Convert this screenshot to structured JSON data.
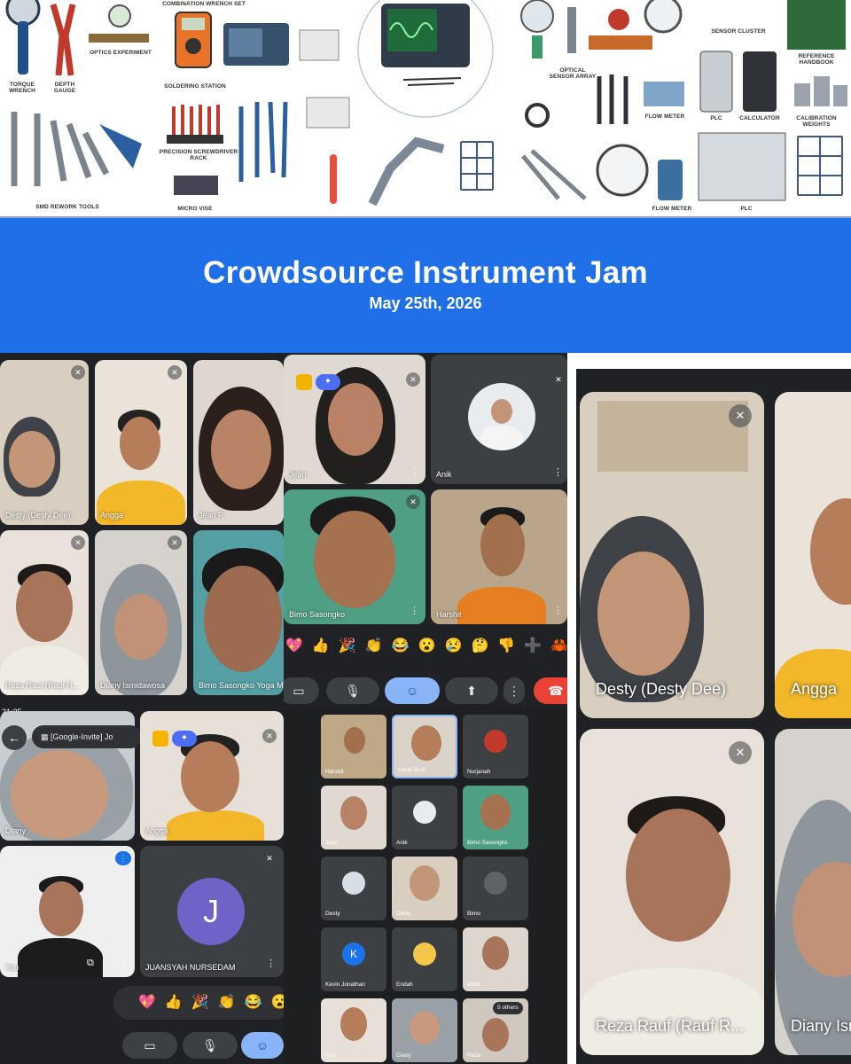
{
  "illustration": {
    "labels": [
      "TORQUE WRENCH",
      "DEPTH GAUGE",
      "OPTICS EXPERIMENT",
      "COMBINATION WRENCH SET",
      "SOLDERING STATION",
      "PRECISION SCREWDRIVER RACK",
      "MICRO VISE",
      "SMD REWORK TOOLS",
      "OPTICAL SENSOR ARRAY",
      "FLOW METER",
      "FLOW METER",
      "SENSOR CLUSTER",
      "PLC",
      "CALCULATOR",
      "PLC",
      "REFERENCE HANDBOOK",
      "CALIBRATION WEIGHTS"
    ]
  },
  "banner": {
    "title": "Crowdsource Instrument Jam",
    "date": "May 25th, 2026",
    "color": "#1f6fe8"
  },
  "grid_a": {
    "tiles": [
      "Desty (Desty Dee)",
      "Angga",
      "Jean P",
      "Reza Rauf (Rauf R...",
      "Diany Ismidawosa",
      "Bimo Sasongko Yoga M"
    ]
  },
  "grid_b": {
    "tiles": [
      "Jean",
      "Anik",
      "Bimo Sasongko",
      "Harshit"
    ],
    "reactions": [
      "💖",
      "👍",
      "🎉",
      "👏",
      "😂",
      "😮",
      "😢",
      "🤔",
      "👎",
      "➕",
      "🦀"
    ]
  },
  "grid_c": {
    "status_time": "21:25",
    "invite_chip": "[Google-Invite] Jo",
    "tiles": [
      "Diany",
      "Angga",
      "You",
      "JUANSYAH NURSEDAM"
    ],
    "avatar_letter": "J",
    "reactions": [
      "💖",
      "👍",
      "🎉",
      "👏",
      "😂",
      "😮"
    ]
  },
  "grid_d": {
    "tiles": [
      "Harshit",
      "Gede Budi",
      "Nurjanah",
      "Jean",
      "Anik",
      "Bimo Sasongko",
      "Desty",
      "Desty",
      "Bimo",
      "Kevin Jonathan",
      "Endah",
      "Work",
      "You",
      "Diany",
      "Reza"
    ],
    "avatar_letter": "K",
    "others_badge": "5 others"
  },
  "grid_e": {
    "tiles": [
      "Desty (Desty Dee)",
      "Angga",
      "Reza Rauf (Rauf R...",
      "Diany Ism"
    ]
  },
  "colors": {
    "meet_dark": "#202124",
    "tile_grey": "#3c4043",
    "end_call": "#ea4335",
    "active_control": "#8ab4f8"
  }
}
